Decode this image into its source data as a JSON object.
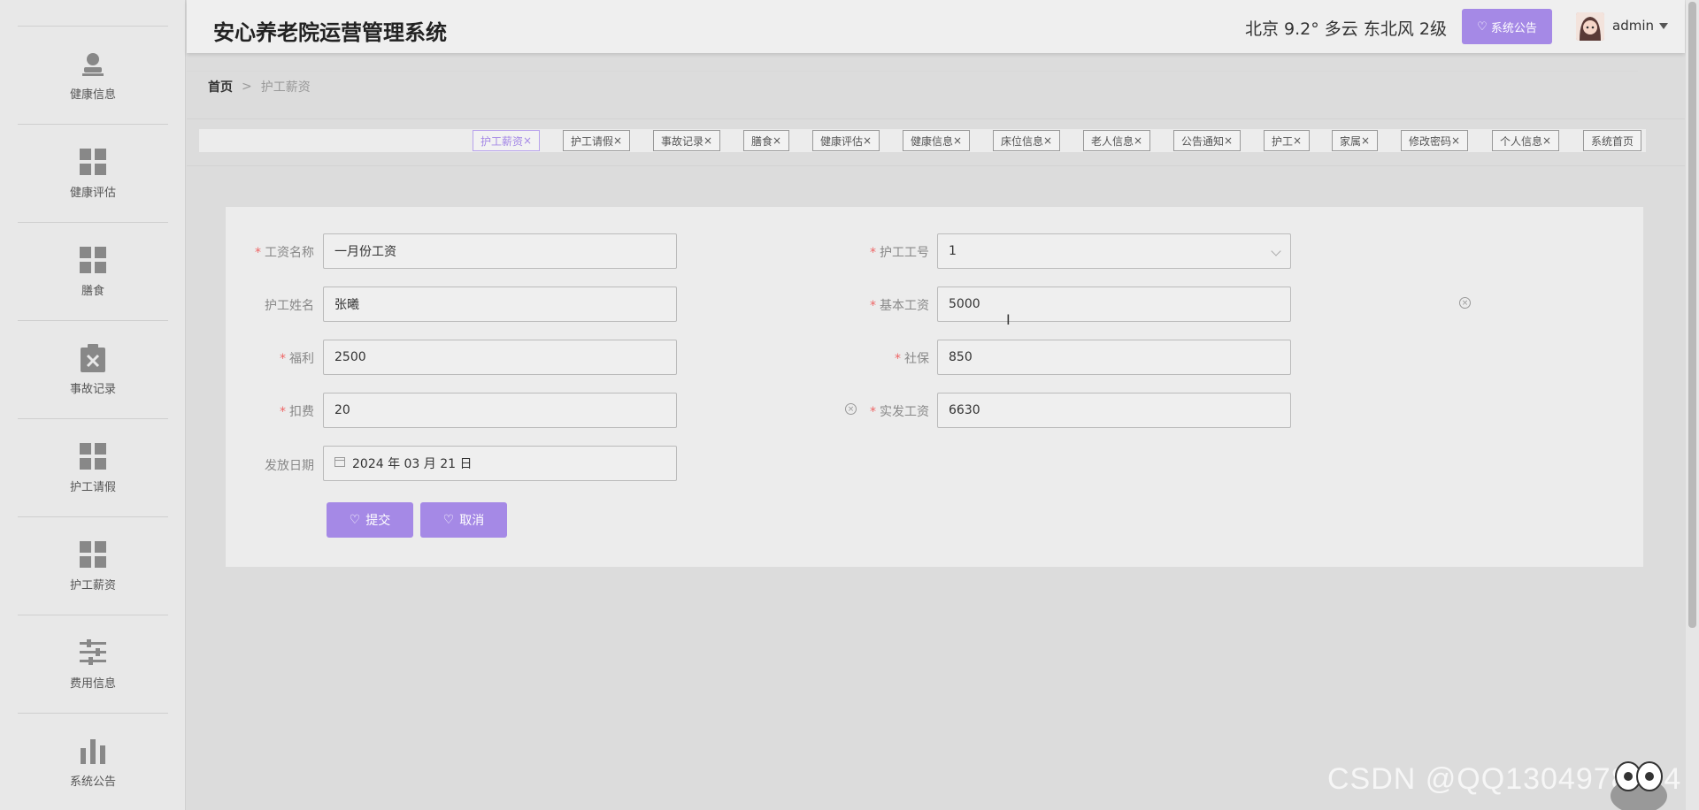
{
  "header": {
    "title": "安心养老院运营管理系统",
    "weather": "北京  9.2°  多云  东北风  2级",
    "notice_button": "系统公告",
    "username": "admin",
    "accent_color": "#a589e6"
  },
  "sidebar": {
    "items": [
      {
        "label": "健康信息",
        "icon": "user-icon"
      },
      {
        "label": "健康评估",
        "icon": "grid-icon"
      },
      {
        "label": "膳食",
        "icon": "grid-icon"
      },
      {
        "label": "事故记录",
        "icon": "clipboard-x-icon"
      },
      {
        "label": "护工请假",
        "icon": "grid-icon"
      },
      {
        "label": "护工薪资",
        "icon": "grid-icon"
      },
      {
        "label": "费用信息",
        "icon": "sliders-icon"
      },
      {
        "label": "系统公告",
        "icon": "bar-chart-icon"
      }
    ]
  },
  "breadcrumb": {
    "home": "首页",
    "separator": ">",
    "current": "护工薪资"
  },
  "tabs": [
    {
      "label": "护工薪资",
      "close": "×",
      "active": true
    },
    {
      "label": "护工请假",
      "close": "×"
    },
    {
      "label": "事故记录",
      "close": "×"
    },
    {
      "label": "膳食",
      "close": "×"
    },
    {
      "label": "健康评估",
      "close": "×"
    },
    {
      "label": "健康信息",
      "close": "×"
    },
    {
      "label": "床位信息",
      "close": "×"
    },
    {
      "label": "老人信息",
      "close": "×"
    },
    {
      "label": "公告通知",
      "close": "×"
    },
    {
      "label": "护工",
      "close": "×"
    },
    {
      "label": "家属",
      "close": "×"
    },
    {
      "label": "修改密码",
      "close": "×"
    },
    {
      "label": "个人信息",
      "close": "×"
    },
    {
      "label": "系统首页",
      "close": ""
    }
  ],
  "form": {
    "required_mark": "*",
    "salary_name": {
      "label": "工资名称",
      "value": "一月份工资"
    },
    "worker_no": {
      "label": "护工工号",
      "value": "1"
    },
    "worker_name": {
      "label": "护工姓名",
      "value": "张曦"
    },
    "base_salary": {
      "label": "基本工资",
      "value": "5000"
    },
    "welfare": {
      "label": "福利",
      "value": "2500"
    },
    "social_security": {
      "label": "社保",
      "value": "850"
    },
    "deduction": {
      "label": "扣费",
      "value": "20"
    },
    "net_salary": {
      "label": "实发工资",
      "value": "6630"
    },
    "pay_date": {
      "label": "发放日期",
      "value": "2024 年 03 月 21 日"
    },
    "submit": "提交",
    "cancel": "取消",
    "clear_glyph": "×"
  },
  "watermark": "CSDN @QQ1304978694"
}
